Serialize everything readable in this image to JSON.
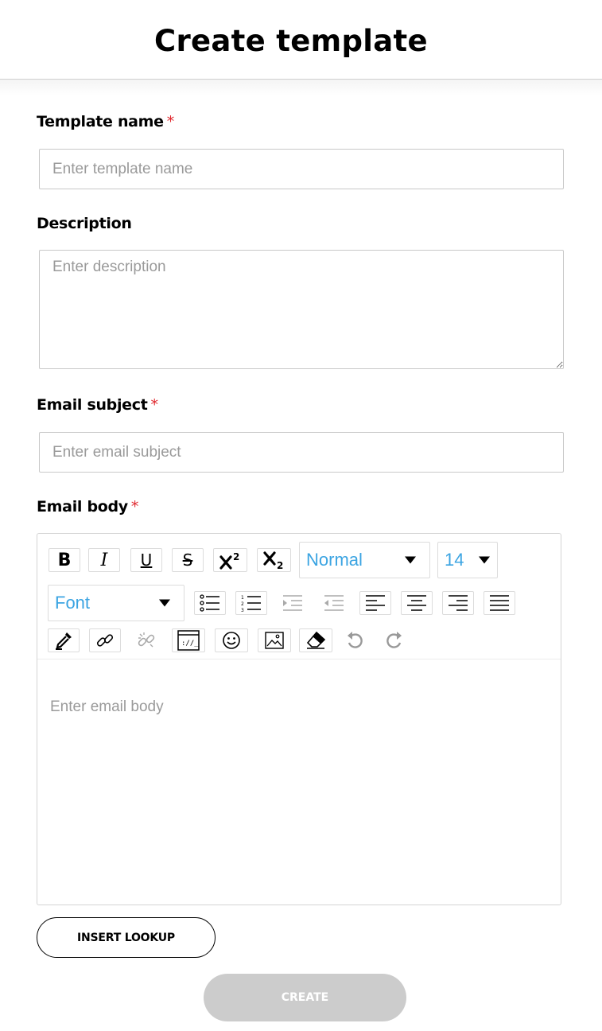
{
  "header": {
    "title": "Create template"
  },
  "form": {
    "template_name": {
      "label": "Template name",
      "required_mark": "*",
      "placeholder": "Enter template name",
      "value": ""
    },
    "description": {
      "label": "Description",
      "placeholder": "Enter description",
      "value": ""
    },
    "email_subject": {
      "label": "Email subject",
      "required_mark": "*",
      "placeholder": "Enter email subject",
      "value": ""
    },
    "email_body": {
      "label": "Email body",
      "required_mark": "*",
      "placeholder": "Enter email body",
      "toolbar": {
        "bold": "B",
        "italic": "I",
        "underline": "U",
        "strikethrough": "S",
        "format_select": "Normal",
        "size_select": "14",
        "font_select": "Font",
        "icons": [
          "bold-icon",
          "italic-icon",
          "underline-icon",
          "strikethrough-icon",
          "superscript-icon",
          "subscript-icon",
          "bulleted-list-icon",
          "numbered-list-icon",
          "indent-icon",
          "outdent-icon",
          "align-left-icon",
          "align-center-icon",
          "align-right-icon",
          "align-justify-icon",
          "color-picker-icon",
          "link-icon",
          "unlink-icon",
          "embed-icon",
          "emoji-icon",
          "image-icon",
          "eraser-icon",
          "undo-icon",
          "redo-icon"
        ]
      }
    }
  },
  "actions": {
    "insert_lookup": "INSERT LOOKUP",
    "create": "CREATE"
  },
  "colors": {
    "accent_blue": "#3ba4e2",
    "required_red": "#e0282e",
    "disabled_button": "#cccccc"
  }
}
